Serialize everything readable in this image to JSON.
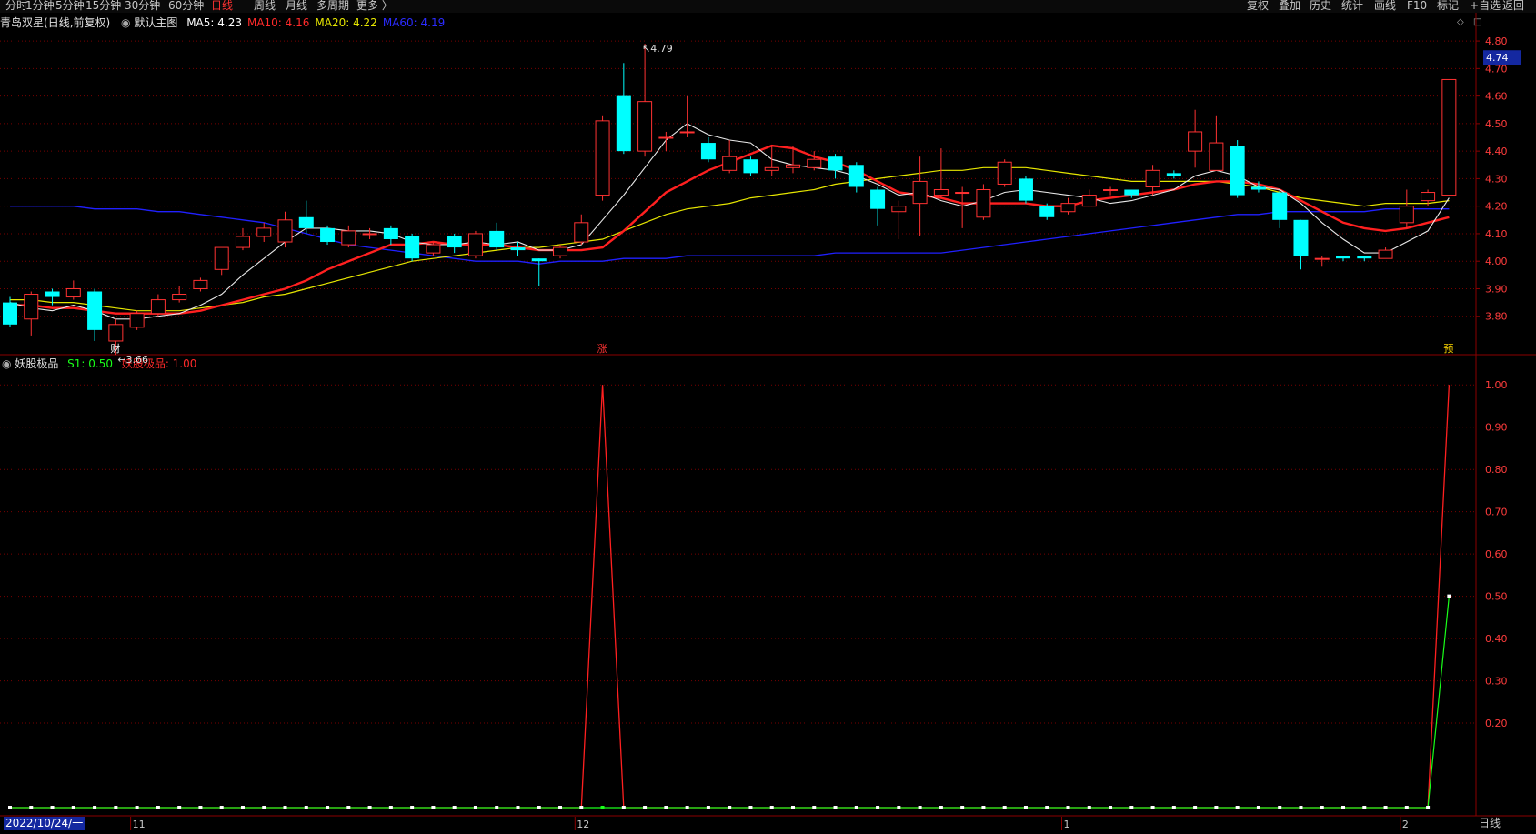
{
  "toolbar": {
    "left_items": [
      "分时",
      "1分钟",
      "5分钟",
      "15分钟",
      "30分钟",
      "60分钟",
      "日线",
      "周线",
      "月线",
      "多周期",
      "更多 〉"
    ],
    "active": "日线",
    "right_items": [
      "复权",
      "叠加",
      "历史",
      "统计",
      "画线",
      "F10",
      "标记",
      "+自选",
      "返回"
    ]
  },
  "stock": {
    "name": "青岛双星",
    "mode": "(日线,前复权)",
    "template": "默认主图",
    "ma": [
      {
        "label": "MA5:",
        "value": "4.23",
        "color": "#ffffff"
      },
      {
        "label": "MA10:",
        "value": "4.16",
        "color": "#ff2a2a"
      },
      {
        "label": "MA20:",
        "value": "4.22",
        "color": "#e6e600"
      },
      {
        "label": "MA60:",
        "value": "4.19",
        "color": "#2b2bff"
      }
    ],
    "price_tag": "4.74",
    "high_label": "4.79",
    "low_label": "3.66"
  },
  "indicator": {
    "name": "妖股极品",
    "s1_label": "S1: 0.50",
    "s1_color": "#19ff19",
    "val_label": "妖股极品: 1.00",
    "val_color": "#ff2a2a"
  },
  "axis": {
    "price_ticks": [
      "4.80",
      "4.70",
      "4.60",
      "4.50",
      "4.40",
      "4.30",
      "4.20",
      "4.10",
      "4.00",
      "3.90",
      "3.80"
    ],
    "ind_ticks": [
      "1.00",
      "0.90",
      "0.80",
      "0.70",
      "0.60",
      "0.50",
      "0.40",
      "0.30",
      "0.20"
    ],
    "dates": [
      "2022/10/24/一",
      "11",
      "12",
      "1",
      "2"
    ],
    "period": "日线"
  },
  "markers": [
    "财",
    "涨",
    "预"
  ],
  "colors": {
    "up": "#ff3232",
    "down": "#00ffff",
    "grid": "#780000",
    "axis_text": "#ff3c3c"
  },
  "chart_data": {
    "type": "candlestick",
    "candles": [
      [
        3.85,
        3.77,
        3.87,
        3.76
      ],
      [
        3.79,
        3.88,
        3.89,
        3.73
      ],
      [
        3.89,
        3.87,
        3.9,
        3.84
      ],
      [
        3.87,
        3.9,
        3.93,
        3.86
      ],
      [
        3.89,
        3.75,
        3.9,
        3.71
      ],
      [
        3.71,
        3.77,
        3.79,
        3.66
      ],
      [
        3.76,
        3.81,
        3.82,
        3.75
      ],
      [
        3.81,
        3.86,
        3.88,
        3.8
      ],
      [
        3.86,
        3.88,
        3.91,
        3.85
      ],
      [
        3.9,
        3.93,
        3.94,
        3.89
      ],
      [
        3.97,
        4.05,
        4.05,
        3.95
      ],
      [
        4.05,
        4.09,
        4.12,
        4.04
      ],
      [
        4.09,
        4.12,
        4.14,
        4.07
      ],
      [
        4.07,
        4.15,
        4.18,
        4.05
      ],
      [
        4.16,
        4.12,
        4.22,
        4.1
      ],
      [
        4.12,
        4.07,
        4.13,
        4.06
      ],
      [
        4.06,
        4.11,
        4.13,
        4.05
      ],
      [
        4.1,
        4.1,
        4.12,
        4.08
      ],
      [
        4.12,
        4.08,
        4.13,
        4.06
      ],
      [
        4.09,
        4.01,
        4.1,
        4.0
      ],
      [
        4.03,
        4.06,
        4.07,
        4.02
      ],
      [
        4.09,
        4.05,
        4.1,
        4.03
      ],
      [
        4.02,
        4.1,
        4.11,
        4.01
      ],
      [
        4.11,
        4.05,
        4.14,
        4.04
      ],
      [
        4.05,
        4.04,
        4.07,
        4.02
      ],
      [
        4.01,
        4.0,
        4.01,
        3.91
      ],
      [
        4.02,
        4.05,
        4.06,
        4.01
      ],
      [
        4.07,
        4.14,
        4.17,
        4.06
      ],
      [
        4.24,
        4.51,
        4.53,
        4.22
      ],
      [
        4.6,
        4.4,
        4.72,
        4.39
      ],
      [
        4.4,
        4.58,
        4.79,
        4.38
      ],
      [
        4.45,
        4.45,
        4.47,
        4.4
      ],
      [
        4.47,
        4.47,
        4.6,
        4.45
      ],
      [
        4.43,
        4.37,
        4.45,
        4.36
      ],
      [
        4.33,
        4.38,
        4.44,
        4.32
      ],
      [
        4.37,
        4.32,
        4.38,
        4.31
      ],
      [
        4.33,
        4.34,
        4.42,
        4.31
      ],
      [
        4.34,
        4.35,
        4.42,
        4.32
      ],
      [
        4.34,
        4.37,
        4.4,
        4.33
      ],
      [
        4.38,
        4.33,
        4.39,
        4.3
      ],
      [
        4.35,
        4.27,
        4.36,
        4.25
      ],
      [
        4.26,
        4.19,
        4.27,
        4.13
      ],
      [
        4.18,
        4.2,
        4.22,
        4.08
      ],
      [
        4.21,
        4.29,
        4.38,
        4.09
      ],
      [
        4.24,
        4.26,
        4.41,
        4.23
      ],
      [
        4.25,
        4.25,
        4.27,
        4.12
      ],
      [
        4.16,
        4.26,
        4.28,
        4.15
      ],
      [
        4.28,
        4.36,
        4.37,
        4.27
      ],
      [
        4.3,
        4.22,
        4.31,
        4.21
      ],
      [
        4.2,
        4.16,
        4.21,
        4.15
      ],
      [
        4.18,
        4.21,
        4.23,
        4.17
      ],
      [
        4.2,
        4.24,
        4.26,
        4.2
      ],
      [
        4.26,
        4.26,
        4.27,
        4.24
      ],
      [
        4.26,
        4.24,
        4.26,
        4.23
      ],
      [
        4.27,
        4.33,
        4.35,
        4.24
      ],
      [
        4.32,
        4.31,
        4.33,
        4.3
      ],
      [
        4.4,
        4.47,
        4.55,
        4.34
      ],
      [
        4.33,
        4.43,
        4.53,
        4.33
      ],
      [
        4.42,
        4.24,
        4.44,
        4.23
      ],
      [
        4.27,
        4.26,
        4.29,
        4.25
      ],
      [
        4.25,
        4.15,
        4.26,
        4.12
      ],
      [
        4.15,
        4.02,
        4.15,
        3.97
      ],
      [
        4.01,
        4.01,
        4.02,
        3.98
      ],
      [
        4.02,
        4.01,
        4.02,
        4.0
      ],
      [
        4.02,
        4.01,
        4.02,
        4.0
      ],
      [
        4.01,
        4.04,
        4.05,
        4.01
      ],
      [
        4.14,
        4.2,
        4.26,
        4.12
      ],
      [
        4.22,
        4.25,
        4.26,
        4.2
      ],
      [
        4.24,
        4.66,
        4.66,
        4.24
      ]
    ],
    "ma60": [
      4.2,
      4.2,
      4.2,
      4.2,
      4.19,
      4.19,
      4.19,
      4.18,
      4.18,
      4.17,
      4.16,
      4.15,
      4.14,
      4.12,
      4.1,
      4.08,
      4.06,
      4.05,
      4.04,
      4.03,
      4.02,
      4.01,
      4.0,
      4.0,
      4.0,
      3.99,
      4.0,
      4.0,
      4.0,
      4.01,
      4.01,
      4.01,
      4.02,
      4.02,
      4.02,
      4.02,
      4.02,
      4.02,
      4.02,
      4.03,
      4.03,
      4.03,
      4.03,
      4.03,
      4.03,
      4.04,
      4.05,
      4.06,
      4.07,
      4.08,
      4.09,
      4.1,
      4.11,
      4.12,
      4.13,
      4.14,
      4.15,
      4.16,
      4.17,
      4.17,
      4.18,
      4.18,
      4.18,
      4.18,
      4.18,
      4.19,
      4.19,
      4.19,
      4.19
    ],
    "ma20": [
      3.86,
      3.86,
      3.85,
      3.85,
      3.84,
      3.83,
      3.82,
      3.82,
      3.82,
      3.83,
      3.84,
      3.85,
      3.87,
      3.88,
      3.9,
      3.92,
      3.94,
      3.96,
      3.98,
      4.0,
      4.01,
      4.02,
      4.03,
      4.04,
      4.05,
      4.05,
      4.06,
      4.07,
      4.08,
      4.11,
      4.14,
      4.17,
      4.19,
      4.2,
      4.21,
      4.23,
      4.24,
      4.25,
      4.26,
      4.28,
      4.29,
      4.3,
      4.31,
      4.32,
      4.33,
      4.33,
      4.34,
      4.34,
      4.34,
      4.33,
      4.32,
      4.31,
      4.3,
      4.29,
      4.29,
      4.29,
      4.29,
      4.29,
      4.28,
      4.27,
      4.25,
      4.23,
      4.22,
      4.21,
      4.2,
      4.21,
      4.21,
      4.21,
      4.22
    ],
    "ma10": [
      3.84,
      3.84,
      3.83,
      3.83,
      3.82,
      3.81,
      3.81,
      3.81,
      3.81,
      3.82,
      3.84,
      3.86,
      3.88,
      3.9,
      3.93,
      3.97,
      4.0,
      4.03,
      4.06,
      4.06,
      4.07,
      4.06,
      4.06,
      4.06,
      4.05,
      4.04,
      4.04,
      4.04,
      4.05,
      4.11,
      4.18,
      4.25,
      4.29,
      4.33,
      4.36,
      4.39,
      4.42,
      4.41,
      4.38,
      4.36,
      4.33,
      4.29,
      4.25,
      4.24,
      4.23,
      4.21,
      4.21,
      4.21,
      4.21,
      4.2,
      4.2,
      4.22,
      4.23,
      4.24,
      4.25,
      4.26,
      4.28,
      4.29,
      4.29,
      4.28,
      4.26,
      4.22,
      4.18,
      4.14,
      4.12,
      4.11,
      4.12,
      4.14,
      4.16
    ],
    "ma5": [
      3.85,
      3.83,
      3.82,
      3.84,
      3.82,
      3.79,
      3.79,
      3.8,
      3.81,
      3.84,
      3.88,
      3.95,
      4.01,
      4.07,
      4.12,
      4.12,
      4.11,
      4.11,
      4.1,
      4.07,
      4.06,
      4.06,
      4.07,
      4.06,
      4.07,
      4.04,
      4.04,
      4.06,
      4.15,
      4.24,
      4.34,
      4.44,
      4.5,
      4.46,
      4.44,
      4.43,
      4.37,
      4.35,
      4.34,
      4.33,
      4.31,
      4.28,
      4.24,
      4.25,
      4.22,
      4.2,
      4.22,
      4.25,
      4.26,
      4.25,
      4.24,
      4.23,
      4.21,
      4.22,
      4.24,
      4.26,
      4.31,
      4.33,
      4.31,
      4.27,
      4.26,
      4.21,
      4.14,
      4.08,
      4.03,
      4.03,
      4.07,
      4.11,
      4.23
    ],
    "indicator_val": [
      0,
      0,
      0,
      0,
      0,
      0,
      0,
      0,
      0,
      0,
      0,
      0,
      0,
      0,
      0,
      0,
      0,
      0,
      0,
      0,
      0,
      0,
      0,
      0,
      0,
      0,
      0,
      0,
      1,
      0,
      0,
      0,
      0,
      0,
      0,
      0,
      0,
      0,
      0,
      0,
      0,
      0,
      0,
      0,
      0,
      0,
      0,
      0,
      0,
      0,
      0,
      0,
      0,
      0,
      0,
      0,
      0,
      0,
      0,
      0,
      0,
      0,
      0,
      0,
      0,
      0,
      0,
      0,
      1
    ],
    "indicator_s1": [
      0,
      0,
      0,
      0,
      0,
      0,
      0,
      0,
      0,
      0,
      0,
      0,
      0,
      0,
      0,
      0,
      0,
      0,
      0,
      0,
      0,
      0,
      0,
      0,
      0,
      0,
      0,
      0,
      0,
      0,
      0,
      0,
      0,
      0,
      0,
      0,
      0,
      0,
      0,
      0,
      0,
      0,
      0,
      0,
      0,
      0,
      0,
      0,
      0,
      0,
      0,
      0,
      0,
      0,
      0,
      0,
      0,
      0,
      0,
      0,
      0,
      0,
      0,
      0,
      0,
      0,
      0,
      0,
      0.5
    ],
    "price_range": [
      3.7,
      4.83
    ],
    "indicator_range": [
      0,
      1.05
    ]
  }
}
